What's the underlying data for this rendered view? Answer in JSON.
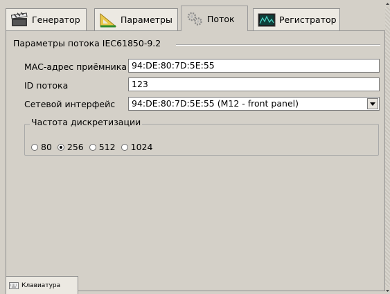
{
  "tabs": [
    {
      "label": "Генератор",
      "icon": "clapperboard-icon"
    },
    {
      "label": "Параметры",
      "icon": "ruler-triangle-icon"
    },
    {
      "label": "Поток",
      "icon": "gears-icon",
      "active": true
    },
    {
      "label": "Регистратор",
      "icon": "oscilloscope-icon"
    }
  ],
  "stream": {
    "group_title": "Параметры потока IEC61850-9.2",
    "mac_label": "MAC-адрес приёмника",
    "mac_value": "94:DE:80:7D:5E:55",
    "id_label": "ID потока",
    "id_value": "123",
    "iface_label": "Сетевой интерфейс",
    "iface_value": "94:DE:80:7D:5E:55 (M12 - front panel)",
    "rate_title": "Частота дискретизации",
    "rates": [
      {
        "label": "80",
        "checked": false
      },
      {
        "label": "256",
        "checked": true
      },
      {
        "label": "512",
        "checked": false
      },
      {
        "label": "1024",
        "checked": false
      }
    ]
  },
  "keyboard_tab": "Клавиатура"
}
